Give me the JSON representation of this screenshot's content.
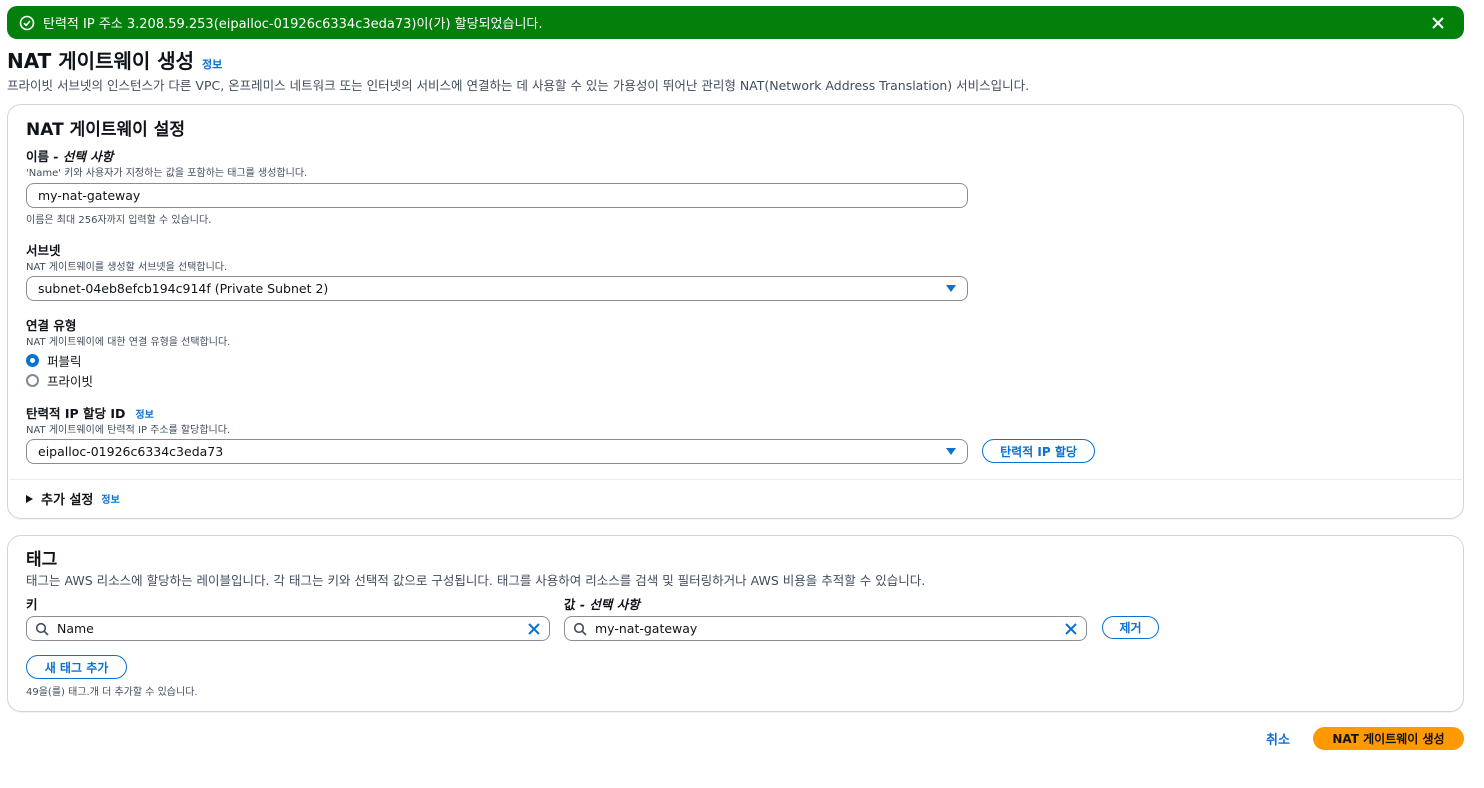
{
  "flash": {
    "message": "탄력적 IP 주소 3.208.59.253(eipalloc-01926c6334c3eda73)이(가) 할당되었습니다.",
    "icon": "check-circle-icon",
    "close_icon": "close-icon",
    "color": "#037f0c"
  },
  "header": {
    "title": "NAT 게이트웨이 생성",
    "info": "정보",
    "description": "프라이빗 서브넷의 인스턴스가 다른 VPC, 온프레미스 네트워크 또는 인터넷의 서비스에 연결하는 데 사용할 수 있는 가용성이 뛰어난 관리형 NAT(Network Address Translation) 서비스입니다."
  },
  "settings": {
    "heading": "NAT 게이트웨이 설정",
    "name": {
      "label": "이름",
      "optional": " - 선택 사항",
      "description": "'Name' 키와 사용자가 지정하는 값을 포함하는 태그를 생성합니다.",
      "value": "my-nat-gateway",
      "constraint": "이름은 최대 256자까지 입력할 수 있습니다."
    },
    "subnet": {
      "label": "서브넷",
      "description": "NAT 게이트웨이를 생성할 서브넷을 선택합니다.",
      "value": "subnet-04eb8efcb194c914f (Private Subnet 2)"
    },
    "connectivity": {
      "label": "연결 유형",
      "description": "NAT 게이트웨이에 대한 연결 유형을 선택합니다.",
      "options": [
        "퍼블릭",
        "프라이빗"
      ],
      "selected": "퍼블릭"
    },
    "eip": {
      "label": "탄력적 IP 할당 ID",
      "info": "정보",
      "description": "NAT 게이트웨이에 탄력적 IP 주소를 할당합니다.",
      "value": "eipalloc-01926c6334c3eda73",
      "allocate_button": "탄력적 IP 할당"
    },
    "additional": {
      "label": "추가 설정",
      "info": "정보"
    }
  },
  "tags": {
    "heading": "태그",
    "description": "태그는 AWS 리소스에 할당하는 레이블입니다. 각 태그는 키와 선택적 값으로 구성됩니다. 태그를 사용하여 리소스를 검색 및 필터링하거나 AWS 비용을 추적할 수 있습니다.",
    "key_label": "키",
    "value_label": "값",
    "value_optional": " - 선택 사항",
    "rows": [
      {
        "key": "Name",
        "value": "my-nat-gateway",
        "remove": "제거"
      }
    ],
    "add_button": "새 태그 추가",
    "remaining": "49을(를) 태그.개 더 추가할 수 있습니다."
  },
  "footer": {
    "cancel": "취소",
    "submit": "NAT 게이트웨이 생성",
    "submit_color": "#ff9900",
    "link_color": "#0972d3"
  }
}
